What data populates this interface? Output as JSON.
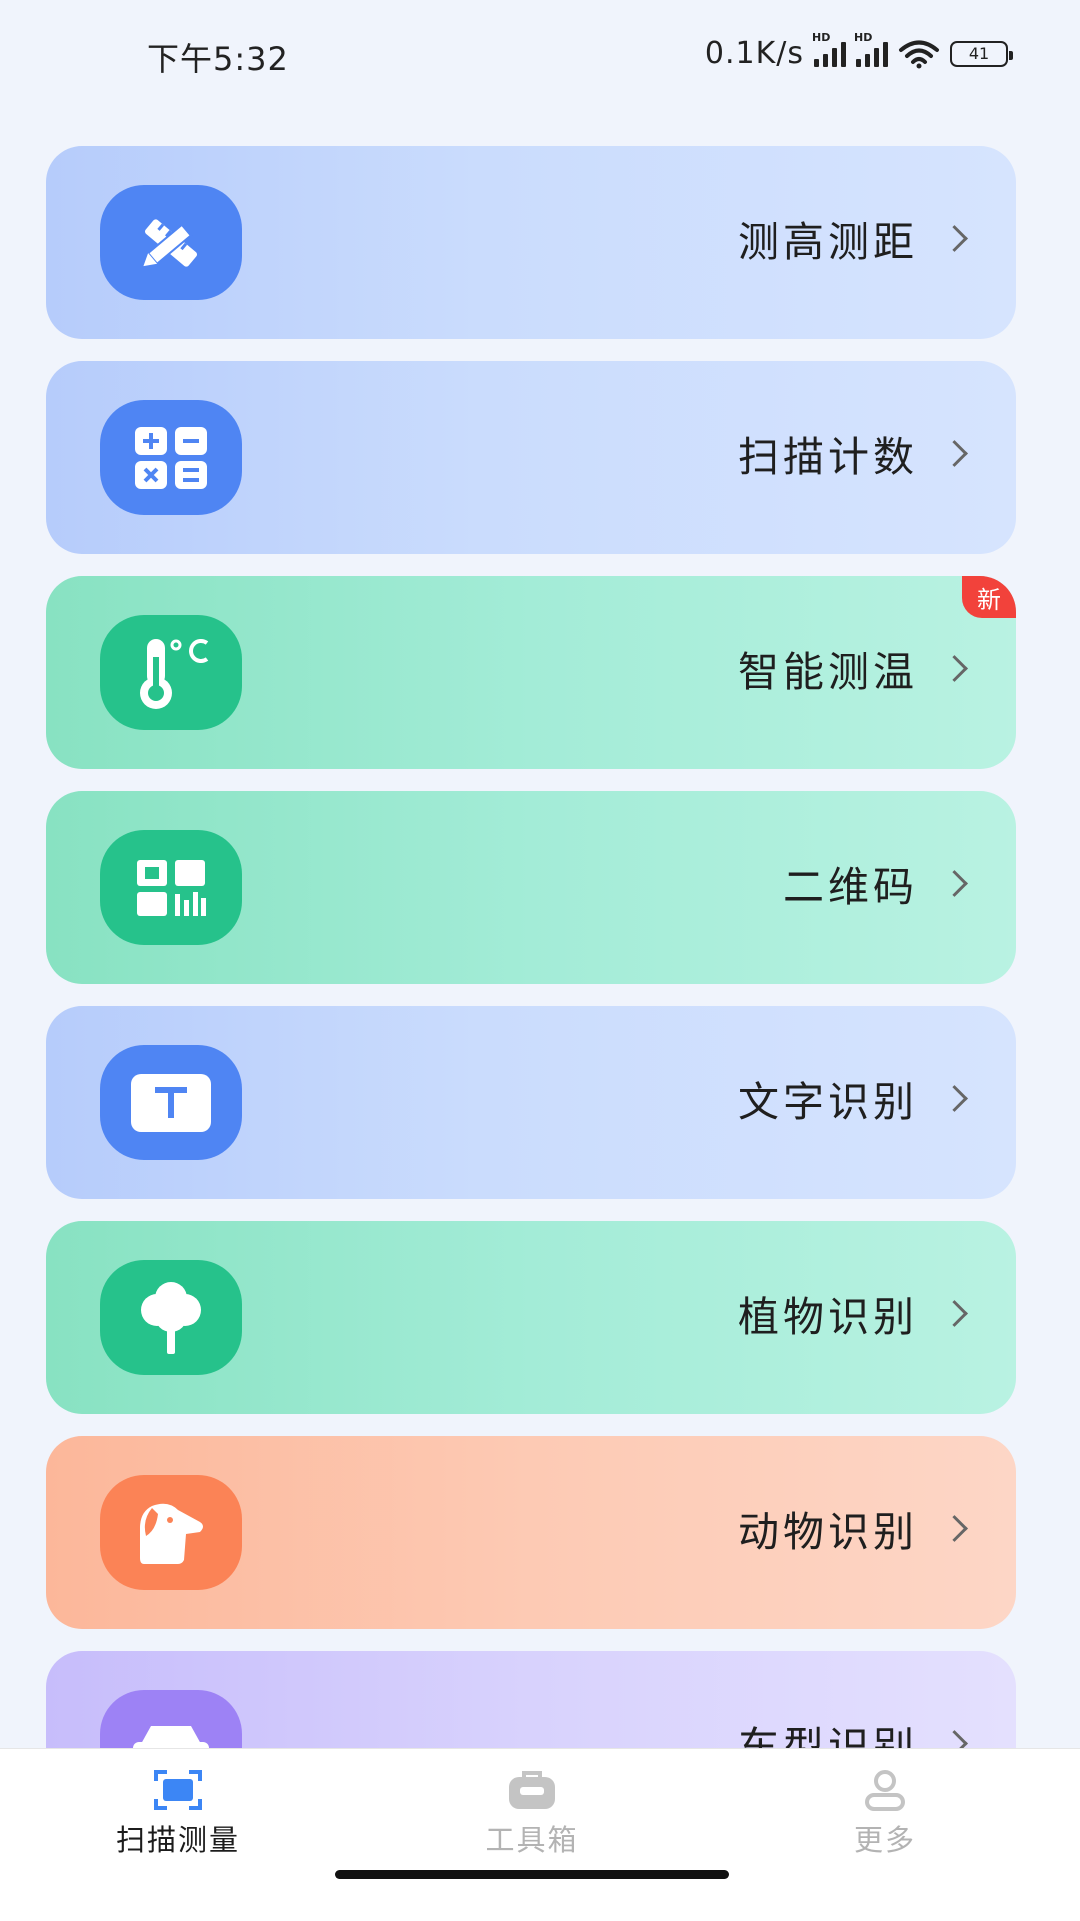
{
  "status_bar": {
    "time": "下午5:32",
    "speed": "0.1K/s",
    "signal_badge": "HD",
    "battery": "41"
  },
  "tools": [
    {
      "label": "测高测距",
      "icon": "pencil-ruler-icon",
      "theme": "blue"
    },
    {
      "label": "扫描计数",
      "icon": "calculator-icon",
      "theme": "blue"
    },
    {
      "label": "智能测温",
      "icon": "thermometer-icon",
      "theme": "green",
      "badge": "新"
    },
    {
      "label": "二维码",
      "icon": "qr-code-icon",
      "theme": "green"
    },
    {
      "label": "文字识别",
      "icon": "text-t-icon",
      "theme": "blue"
    },
    {
      "label": "植物识别",
      "icon": "tree-icon",
      "theme": "green"
    },
    {
      "label": "动物识别",
      "icon": "dog-icon",
      "theme": "orange"
    },
    {
      "label": "车型识别",
      "icon": "car-icon",
      "theme": "purple"
    }
  ],
  "tabbar": {
    "tabs": [
      {
        "label": "扫描测量",
        "icon": "scan-icon",
        "active": true
      },
      {
        "label": "工具箱",
        "icon": "toolbox-icon",
        "active": false
      },
      {
        "label": "更多",
        "icon": "user-icon",
        "active": false
      }
    ]
  },
  "colors": {
    "blue_icon": "#4f85f3",
    "green_icon": "#26c28b",
    "orange_icon": "#fb8356",
    "purple_icon": "#9d82f5",
    "active_tab": "#3c86f5",
    "badge": "#f2423b"
  }
}
